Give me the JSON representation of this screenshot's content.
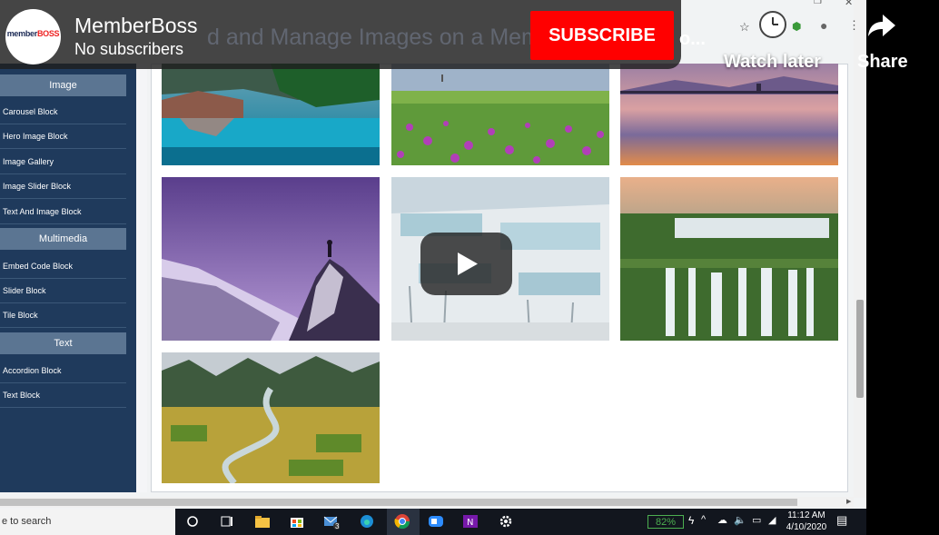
{
  "video_overlay": {
    "channel_name": "MemberBoss",
    "subscribers": "No subscribers",
    "subscribe_label": "SUBSCRIBE",
    "faded_title": "d and Manage Images on a Mem",
    "title_tail": "o...",
    "watch_later_label": "Watch later",
    "share_label": "Share",
    "avatar_text_a": "member",
    "avatar_text_b": "BOSS"
  },
  "sidebar": {
    "sections": [
      {
        "header": "Image",
        "items": [
          "Carousel Block",
          "Hero Image Block",
          "Image Gallery",
          "Image Slider Block",
          "Text And Image Block"
        ]
      },
      {
        "header": "Multimedia",
        "items": [
          "Embed Code Block",
          "Slider Block",
          "Tile Block"
        ]
      },
      {
        "header": "Text",
        "items": [
          "Accordion Block",
          "Text Block"
        ]
      }
    ]
  },
  "gallery": {
    "images": [
      "lake-mountain-reflection",
      "flower-meadow",
      "sunset-lake",
      "purple-mountain-climber",
      "pamukkale-terraces",
      "waterfalls",
      "valley-rice-fields"
    ]
  },
  "taskbar": {
    "search_text": "e to search",
    "battery": "82%",
    "time": "11:12 AM",
    "date": "4/10/2020",
    "mail_badge": "3"
  },
  "colors": {
    "youtube_red": "#ff0000",
    "sidebar_bg": "#1f3a5c",
    "sidebar_header": "#5b7592"
  }
}
